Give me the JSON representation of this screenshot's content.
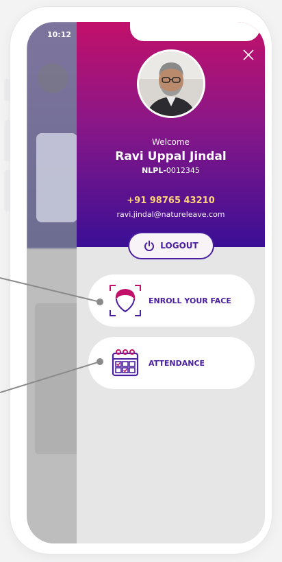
{
  "status_bar": {
    "time": "10:12"
  },
  "profile": {
    "welcome": "Welcome",
    "name": "Ravi Uppal Jindal",
    "emp_prefix": "NLPL-",
    "emp_number": "0012345",
    "phone": "+91 98765 43210",
    "email": "ravi.jindal@natureleave.com"
  },
  "logout": {
    "label": "LOGOUT"
  },
  "menu": [
    {
      "label": "ENROLL YOUR FACE",
      "icon": "face-scan-icon"
    },
    {
      "label": "ATTENDANCE",
      "icon": "calendar-check-icon"
    }
  ],
  "colors": {
    "accent": "#4a1ea0",
    "header_top": "#c2106a",
    "header_bottom": "#3a0f95",
    "phone_text": "#ffd47a"
  }
}
